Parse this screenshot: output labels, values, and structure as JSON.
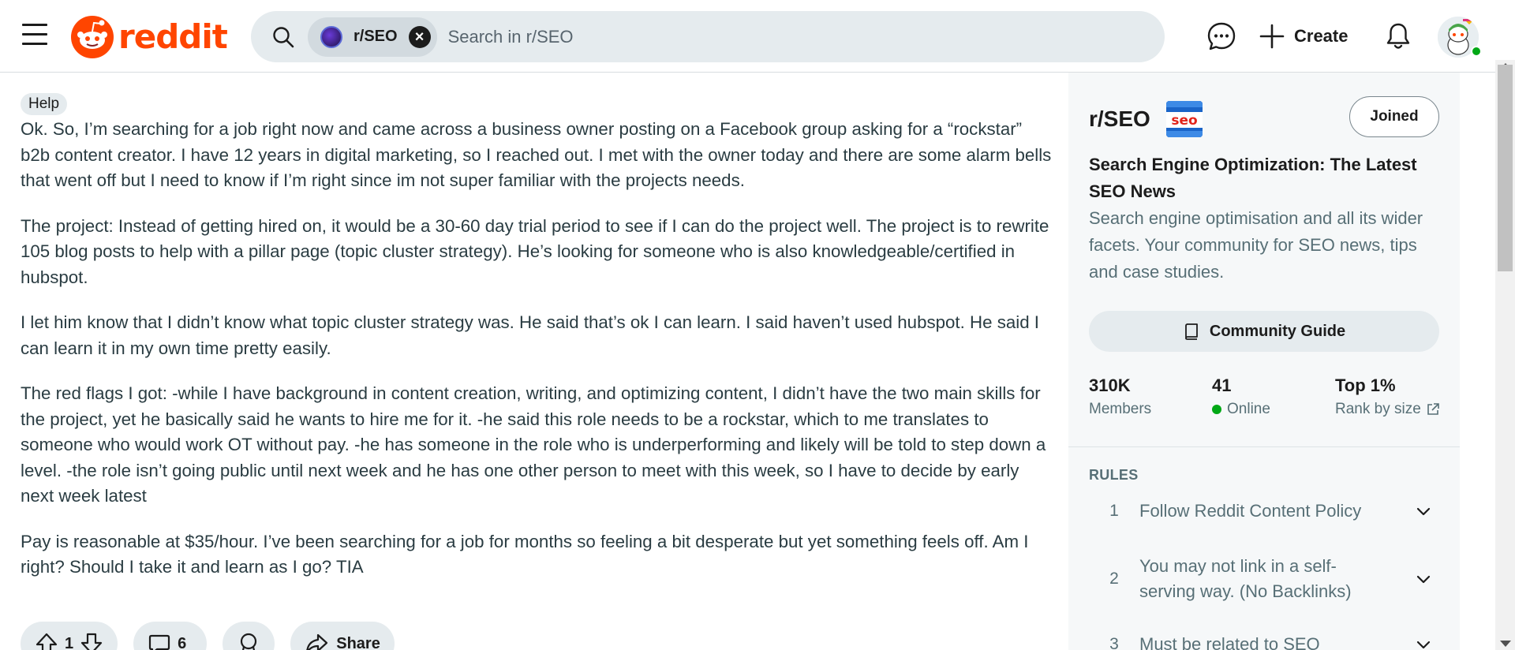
{
  "header": {
    "logo_text": "reddit",
    "search": {
      "chip_label": "r/SEO",
      "placeholder": "Search in r/SEO",
      "value": ""
    },
    "create_label": "Create",
    "icons": [
      "menu-icon",
      "search-icon",
      "close-icon",
      "chat-icon",
      "plus-icon",
      "bell-icon"
    ]
  },
  "post": {
    "flair": "Help",
    "paragraphs": [
      "Ok. So, I’m searching for a job right now and came across a business owner posting on a Facebook group asking for a “rockstar” b2b content creator. I have 12 years in digital marketing, so I reached out. I met with the owner today and there are some alarm bells that went off but I need to know if I’m right since im not super familiar with the projects needs.",
      "The project: Instead of getting hired on, it would be a 30-60 day trial period to see if I can do the project well. The project is to rewrite 105 blog posts to help with a pillar page (topic cluster strategy). He’s looking for someone who is also knowledgeable/certified in hubspot.",
      "I let him know that I didn’t know what topic cluster strategy was. He said that’s ok I can learn. I said haven’t used hubspot. He said I can learn it in my own time pretty easily.",
      "The red flags I got: -while I have background in content creation, writing, and optimizing content, I didn’t have the two main skills for the project, yet he basically said he wants to hire me for it. -he said this role needs to be a rockstar, which to me translates to someone who would work OT without pay. -he has someone in the role who is underperforming and likely will be told to step down a level. -the role isn’t going public until next week and he has one other person to meet with this week, so I have to decide by early next week latest",
      "Pay is reasonable at $35/hour. I’ve been searching for a job for months so feeling a bit desperate but yet something feels off. Am I right? Should I take it and learn as I go? TIA"
    ],
    "vote_count": "1",
    "comment_count": "6",
    "share_label": "Share"
  },
  "sidebar": {
    "name": "r/SEO",
    "seo_icon_text": "seo",
    "joined_label": "Joined",
    "heading": "Search Engine Optimization: The Latest SEO News",
    "description": "Search engine optimisation and all its wider facets. Your community for SEO news, tips and case studies.",
    "guide_label": "Community Guide",
    "stats": [
      {
        "value": "310K",
        "label": "Members"
      },
      {
        "value": "41",
        "label": "Online"
      },
      {
        "value": "Top 1%",
        "label": "Rank by size"
      }
    ],
    "rules_title": "RULES",
    "rules": [
      {
        "num": "1",
        "text": "Follow Reddit Content Policy"
      },
      {
        "num": "2",
        "text": "You may not link in a self-serving way. (No Backlinks)"
      },
      {
        "num": "3",
        "text": "Must be related to SEO"
      }
    ]
  },
  "colors": {
    "brand": "#ff4500",
    "online": "#01a816",
    "search_bg": "#e5ebee",
    "muted_text": "#576f76"
  }
}
